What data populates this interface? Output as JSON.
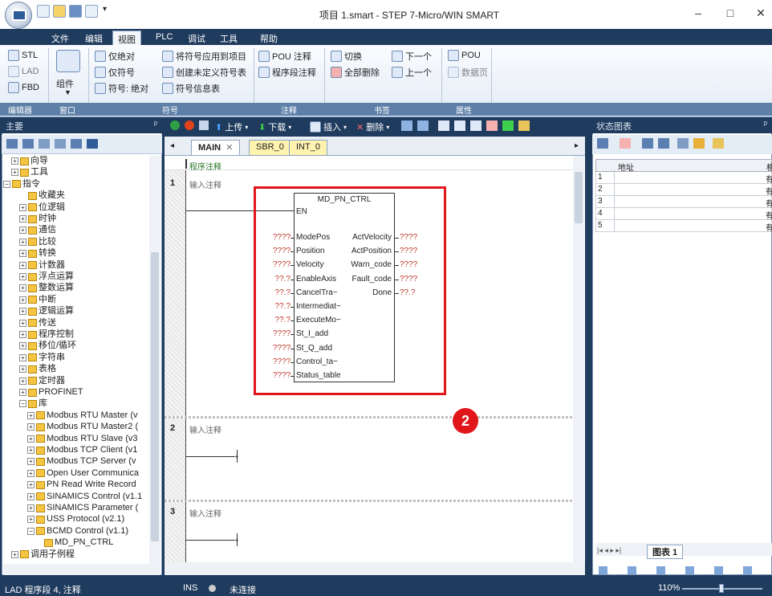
{
  "window": {
    "title": "项目 1.smart - STEP 7-Micro/WIN SMART",
    "minimize": "–",
    "maximize": "□",
    "close": "✕"
  },
  "menus": [
    "文件",
    "编辑",
    "视图",
    "PLC",
    "调试",
    "工具",
    "帮助"
  ],
  "ribbon": {
    "editor": {
      "stl": "STL",
      "lad": "LAD",
      "fbd": "FBD",
      "label": "编辑器"
    },
    "window": {
      "components": "组件",
      "label": "窗口"
    },
    "symbols": {
      "abs_only": "仅绝对",
      "sym_only": "仅符号",
      "sym_abs": "符号: 绝对",
      "apply": "将符号应用到项目",
      "create": "创建未定义符号表",
      "info": "符号信息表",
      "label": "符号"
    },
    "comments": {
      "pou": "POU 注释",
      "segment": "程序段注释",
      "label": "注释"
    },
    "bookmarks": {
      "toggle": "切换",
      "next": "下一个",
      "del_all": "全部删除",
      "prev": "上一个",
      "label": "书签"
    },
    "properties": {
      "pou": "POU",
      "datapage": "数据页",
      "label": "属性"
    }
  },
  "left": {
    "title": "主要",
    "pin": "ᵖ"
  },
  "tree": [
    {
      "label": "向导",
      "exp": "+",
      "indent": 1
    },
    {
      "label": "工具",
      "exp": "+",
      "indent": 1
    },
    {
      "label": "指令",
      "exp": "−",
      "indent": 0
    },
    {
      "label": "收藏夹",
      "exp": "",
      "indent": 2
    },
    {
      "label": "位逻辑",
      "exp": "+",
      "indent": 2
    },
    {
      "label": "时钟",
      "exp": "+",
      "indent": 2
    },
    {
      "label": "通信",
      "exp": "+",
      "indent": 2
    },
    {
      "label": "比较",
      "exp": "+",
      "indent": 2
    },
    {
      "label": "转换",
      "exp": "+",
      "indent": 2
    },
    {
      "label": "计数器",
      "exp": "+",
      "indent": 2
    },
    {
      "label": "浮点运算",
      "exp": "+",
      "indent": 2
    },
    {
      "label": "整数运算",
      "exp": "+",
      "indent": 2
    },
    {
      "label": "中断",
      "exp": "+",
      "indent": 2
    },
    {
      "label": "逻辑运算",
      "exp": "+",
      "indent": 2
    },
    {
      "label": "传送",
      "exp": "+",
      "indent": 2
    },
    {
      "label": "程序控制",
      "exp": "+",
      "indent": 2
    },
    {
      "label": "移位/循环",
      "exp": "+",
      "indent": 2
    },
    {
      "label": "字符串",
      "exp": "+",
      "indent": 2
    },
    {
      "label": "表格",
      "exp": "+",
      "indent": 2
    },
    {
      "label": "定时器",
      "exp": "+",
      "indent": 2
    },
    {
      "label": "PROFINET",
      "exp": "+",
      "indent": 2
    },
    {
      "label": "库",
      "exp": "−",
      "indent": 2
    },
    {
      "label": "Modbus RTU Master (v",
      "exp": "+",
      "indent": 3
    },
    {
      "label": "Modbus RTU Master2 (",
      "exp": "+",
      "indent": 3
    },
    {
      "label": "Modbus RTU Slave (v3",
      "exp": "+",
      "indent": 3
    },
    {
      "label": "Modbus TCP Client (v1",
      "exp": "+",
      "indent": 3
    },
    {
      "label": "Modbus TCP Server (v",
      "exp": "+",
      "indent": 3
    },
    {
      "label": "Open User Communica",
      "exp": "+",
      "indent": 3
    },
    {
      "label": "PN Read Write Record",
      "exp": "+",
      "indent": 3
    },
    {
      "label": "SINAMICS Control (v1.1",
      "exp": "+",
      "indent": 3
    },
    {
      "label": "SINAMICS Parameter (",
      "exp": "+",
      "indent": 3
    },
    {
      "label": "USS Protocol (v2.1)",
      "exp": "+",
      "indent": 3
    },
    {
      "label": "BCMD Control (v1.1)",
      "exp": "−",
      "indent": 3
    },
    {
      "label": "MD_PN_CTRL",
      "exp": "",
      "indent": 4
    },
    {
      "label": "调用子例程",
      "exp": "+",
      "indent": 1
    }
  ],
  "tabs": {
    "main": "MAIN",
    "sbr": "SBR_0",
    "intr": "INT_0",
    "close": "✕"
  },
  "ctoolbar": {
    "upload": "上传",
    "download": "下载",
    "insert": "插入",
    "delete": "删除"
  },
  "editor": {
    "program_comment": "程序注释",
    "rungs": [
      {
        "num": "1",
        "comment": "输入注释"
      },
      {
        "num": "2",
        "comment": "输入注释"
      },
      {
        "num": "3",
        "comment": "输入注释"
      }
    ],
    "block": {
      "name": "MD_PN_CTRL",
      "en": "EN",
      "inputs": [
        {
          "val": "????",
          "pin": "ModePos"
        },
        {
          "val": "????",
          "pin": "Position"
        },
        {
          "val": "????",
          "pin": "Velocity"
        },
        {
          "val": "??.?",
          "pin": "EnableAxis"
        },
        {
          "val": "??.?",
          "pin": "CancelTra~"
        },
        {
          "val": "??.?",
          "pin": "Intermediat~"
        },
        {
          "val": "??.?",
          "pin": "ExecuteMo~"
        },
        {
          "val": "????",
          "pin": "St_I_add"
        },
        {
          "val": "????",
          "pin": "St_Q_add"
        },
        {
          "val": "????",
          "pin": "Control_ta~"
        },
        {
          "val": "????",
          "pin": "Status_table"
        }
      ],
      "outputs": [
        {
          "pin": "ActVelocity",
          "val": "????"
        },
        {
          "pin": "ActPosition",
          "val": "????"
        },
        {
          "pin": "Warn_code",
          "val": "????"
        },
        {
          "pin": "Fault_code",
          "val": "????"
        },
        {
          "pin": "Done",
          "val": "??.?"
        }
      ]
    },
    "marker": "2"
  },
  "right": {
    "title": "状态图表",
    "pin": "ᵖ",
    "col_addr": "地址",
    "col_fmt": "格",
    "rows": [
      "1",
      "2",
      "3",
      "4",
      "5"
    ],
    "fmt_cell": "有",
    "sheet_tab": "图表 1"
  },
  "bottom_tabs": [
    "符.",
    "状.",
    "变.",
    "交.",
    "数.",
    "输"
  ],
  "status": {
    "left": "LAD 程序段 4, 注释",
    "ins": "INS",
    "conn": "未连接",
    "zoom": "110%"
  },
  "colors": {
    "highlight": "#e0161b",
    "titlebar": "#1f3b5e",
    "marker": "#e0161b"
  }
}
